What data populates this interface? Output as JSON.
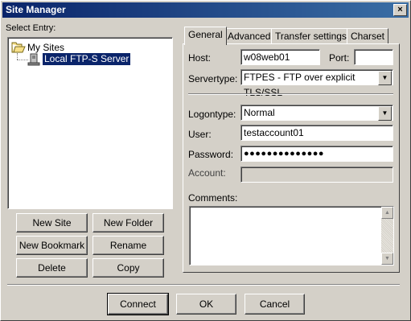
{
  "window": {
    "title": "Site Manager",
    "close_glyph": "×"
  },
  "left": {
    "select_entry_label": "Select Entry:",
    "tree": {
      "root_label": "My Sites",
      "root_icon": "folder-open-icon",
      "child_label": "Local FTP-S Server",
      "child_icon": "server-icon"
    },
    "buttons": {
      "new_site": "New Site",
      "new_folder": "New Folder",
      "new_bookmark": "New Bookmark",
      "rename": "Rename",
      "delete": "Delete",
      "copy": "Copy"
    }
  },
  "tabs": [
    {
      "label": "General",
      "active": true
    },
    {
      "label": "Advanced",
      "active": false
    },
    {
      "label": "Transfer settings",
      "active": false
    },
    {
      "label": "Charset",
      "active": false
    }
  ],
  "general": {
    "host_label": "Host:",
    "host_value": "w08web01",
    "port_label": "Port:",
    "port_value": "",
    "servertype_label": "Servertype:",
    "servertype_value": "FTPES - FTP over explicit TLS/SSL",
    "logontype_label": "Logontype:",
    "logontype_value": "Normal",
    "user_label": "User:",
    "user_value": "testaccount01",
    "password_label": "Password:",
    "password_value": "●●●●●●●●●●●●●●",
    "account_label": "Account:",
    "account_value": "",
    "comments_label": "Comments:",
    "comments_value": ""
  },
  "footer": {
    "connect": "Connect",
    "ok": "OK",
    "cancel": "Cancel"
  },
  "colors": {
    "title_start": "#0a246a",
    "title_end": "#3a6ea5",
    "selection": "#0a246a",
    "face": "#d4d0c8"
  }
}
